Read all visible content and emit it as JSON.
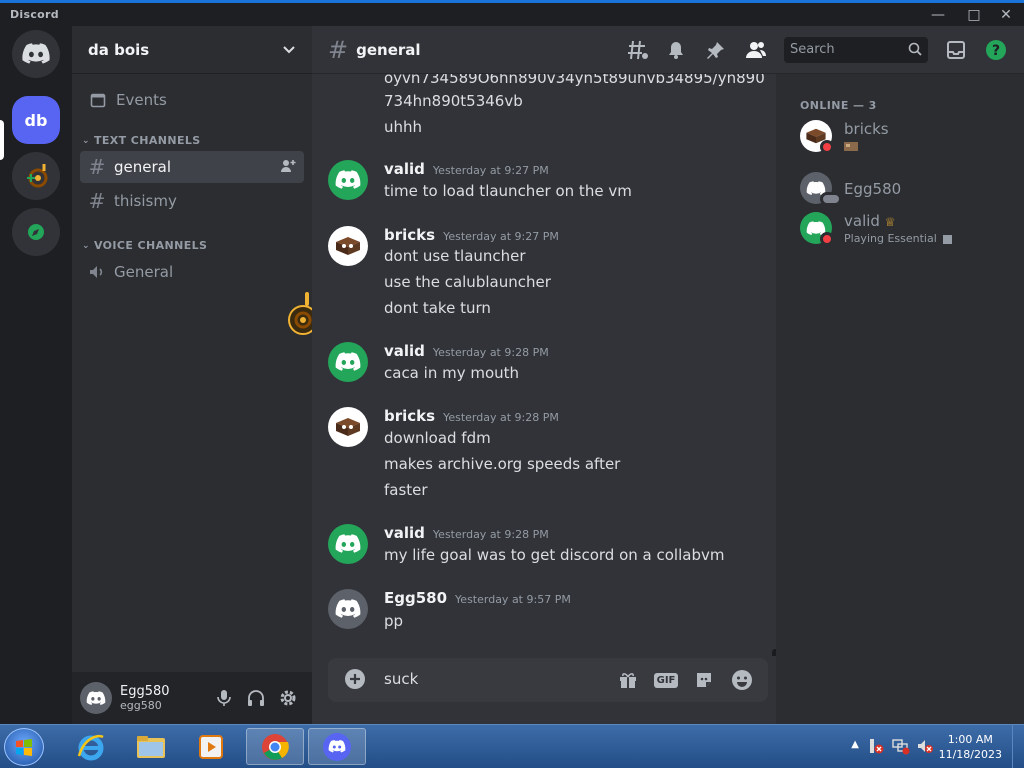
{
  "titlebar": {
    "app_name": "Discord"
  },
  "server": {
    "name": "da bois",
    "active_server_initials": "db"
  },
  "sidebar": {
    "events_label": "Events",
    "text_category": "TEXT CHANNELS",
    "voice_category": "VOICE CHANNELS",
    "text_channels": [
      "general",
      "thisismy"
    ],
    "voice_channels": [
      "General"
    ]
  },
  "user_panel": {
    "name": "Egg580",
    "tag": "egg580"
  },
  "channel": {
    "name": "general"
  },
  "search": {
    "placeholder": "Search"
  },
  "messages": {
    "partial_1": "oyvn734589O6hn890v34yn5t89uhvb34895/yn890",
    "partial_2": "734hn890t5346vb",
    "partial_3": "uhhh",
    "m1": {
      "author": "valid",
      "time": "Yesterday at 9:27 PM",
      "lines": [
        "time to load tlauncher on the vm"
      ]
    },
    "m2": {
      "author": "bricks",
      "time": "Yesterday at 9:27 PM",
      "lines": [
        "dont use tlauncher",
        "use the calublauncher",
        "dont take turn"
      ]
    },
    "m3": {
      "author": "valid",
      "time": "Yesterday at 9:28 PM",
      "lines": [
        "caca in my mouth"
      ]
    },
    "m4": {
      "author": "bricks",
      "time": "Yesterday at 9:28 PM",
      "lines": [
        "download fdm",
        "makes archive.org speeds after",
        "faster"
      ]
    },
    "m5": {
      "author": "valid",
      "time": "Yesterday at 9:28 PM",
      "lines": [
        "my life goal was to get discord on a collabvm"
      ]
    },
    "m6": {
      "author": "Egg580",
      "time": "Yesterday at 9:57 PM",
      "lines": [
        "pp"
      ]
    }
  },
  "composer": {
    "value": "suck"
  },
  "members": {
    "header": "ONLINE — 3",
    "list": [
      {
        "name": "bricks",
        "sub": ""
      },
      {
        "name": "Egg580",
        "sub": ""
      },
      {
        "name": "valid",
        "sub": "Playing Essential"
      }
    ]
  },
  "clock": {
    "time": "1:00 AM",
    "date": "11/18/2023"
  },
  "colors": {
    "blurple": "#5865f2",
    "green": "#23a55a",
    "dnd": "#f23f43",
    "idle": "#f0b232"
  }
}
